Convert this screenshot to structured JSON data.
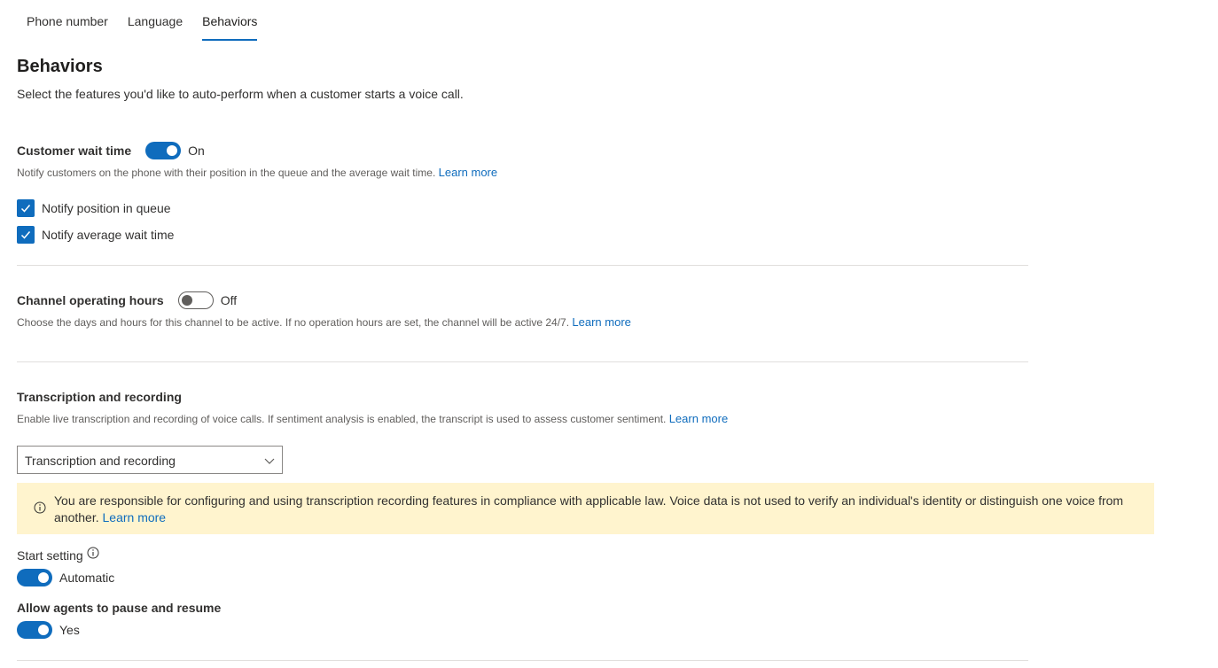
{
  "tabs": [
    {
      "label": "Phone number"
    },
    {
      "label": "Language"
    },
    {
      "label": "Behaviors"
    }
  ],
  "page": {
    "title": "Behaviors",
    "subtitle": "Select the features you'd like to auto-perform when a customer starts a voice call."
  },
  "wait_time": {
    "title": "Customer wait time",
    "toggle_state": "On",
    "description": "Notify customers on the phone with their position in the queue and the average wait time.",
    "learn_more": "Learn more",
    "options": [
      {
        "label": "Notify position in queue",
        "checked": true
      },
      {
        "label": "Notify average wait time",
        "checked": true
      }
    ]
  },
  "operating_hours": {
    "title": "Channel operating hours",
    "toggle_state": "Off",
    "description": "Choose the days and hours for this channel to be active. If no operation hours are set, the channel will be active 24/7.",
    "learn_more": "Learn more"
  },
  "transcription": {
    "title": "Transcription and recording",
    "description": "Enable live transcription and recording of voice calls. If sentiment analysis is enabled, the transcript is used to assess customer sentiment.",
    "learn_more": "Learn more",
    "dropdown_value": "Transcription and recording",
    "banner_text": "You are responsible for configuring and using transcription recording features in compliance with applicable law. Voice data is not used to verify an individual's identity or distinguish one voice from another.",
    "banner_link": "Learn more",
    "start_setting_label": "Start setting",
    "start_setting_value": "Automatic",
    "pause_label": "Allow agents to pause and resume",
    "pause_value": "Yes"
  },
  "colors": {
    "accent": "#0f6cbd",
    "banner_bg": "#fff4ce",
    "divider": "#e1dfdd"
  },
  "icons": [
    "checkmark-icon",
    "chevron-down-icon",
    "info-icon"
  ]
}
